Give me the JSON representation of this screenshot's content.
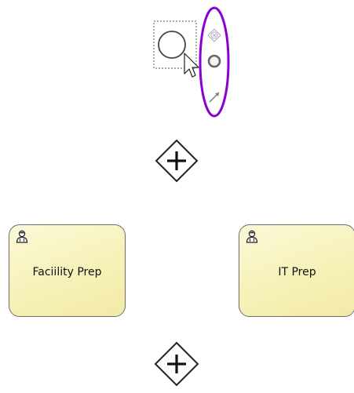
{
  "tasks": [
    {
      "label": "Faciility Prep",
      "icon": "user-task-icon"
    },
    {
      "label": "IT Prep",
      "icon": "user-task-icon"
    }
  ],
  "gateways": [
    {
      "type": "parallel",
      "icon": "plus-icon"
    },
    {
      "type": "parallel",
      "icon": "plus-icon"
    }
  ],
  "context_pad": {
    "highlight_color": "#8a00d4",
    "tools": [
      "exclusive-gateway-icon",
      "end-event-icon",
      "connect-arrow-icon"
    ]
  },
  "selected_element": "start-event"
}
